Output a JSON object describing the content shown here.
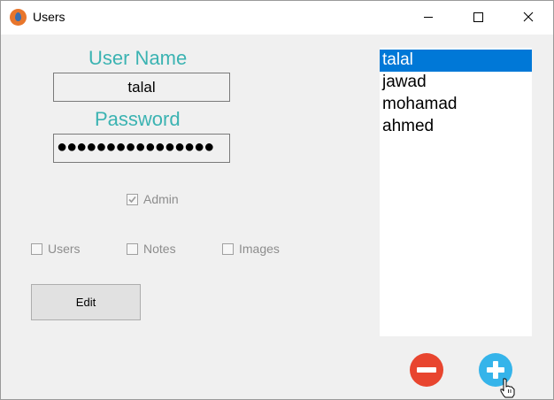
{
  "window": {
    "title": "Users"
  },
  "form": {
    "username_label": "User Name",
    "username_value": "talal",
    "password_label": "Password",
    "password_value": "●●●●●●●●●●●●●●●●",
    "admin_label": "Admin",
    "admin_checked": true,
    "permissions": [
      {
        "label": "Users",
        "checked": false
      },
      {
        "label": "Notes",
        "checked": false
      },
      {
        "label": "Images",
        "checked": false
      }
    ],
    "edit_label": "Edit"
  },
  "users_list": {
    "items": [
      "talal",
      "jawad",
      "mohamad",
      "ahmed"
    ],
    "selected": "talal"
  },
  "colors": {
    "label_teal": "#3bb3b2",
    "selection_blue": "#0078d7",
    "remove_red": "#e8452f",
    "add_blue": "#35b4ea",
    "app_icon_orange": "#e8762c"
  },
  "icons": {
    "app": "app-icon",
    "minimize": "minimize-icon",
    "maximize": "maximize-icon",
    "close": "close-icon",
    "remove": "minus-circle-icon",
    "add": "plus-circle-icon",
    "cursor": "hand-pointer-icon"
  }
}
